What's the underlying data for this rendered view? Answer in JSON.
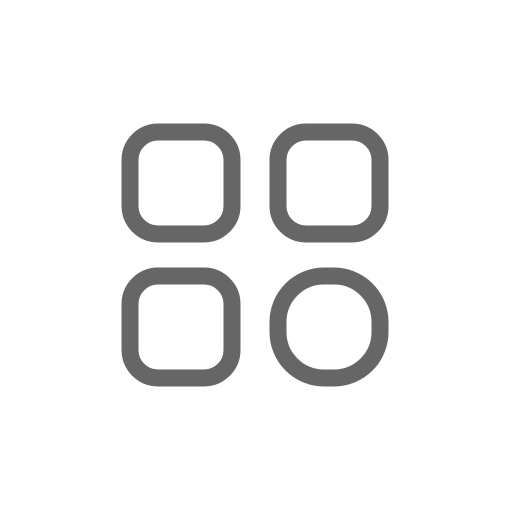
{
  "icon": {
    "name": "apps-grid-icon",
    "color": "#666666",
    "background": "#ffffff"
  }
}
